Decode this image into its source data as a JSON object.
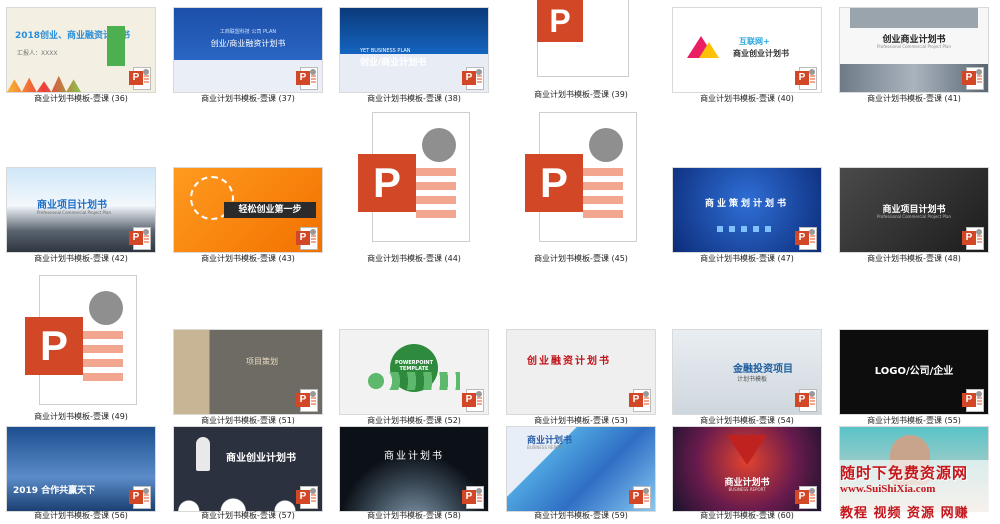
{
  "tiles": [
    {
      "caption": "商业计划书模板-壹课 (36)",
      "title": "2018创业、商业融资计划书",
      "sub": "汇报人：XXXX"
    },
    {
      "caption": "商业计划书模板-壹课 (37)",
      "title": "创业/商业融资计划书",
      "sub": "工商联盟科技 公司 PLAN"
    },
    {
      "caption": "商业计划书模板-壹课 (38)",
      "title": "创业/商业计划书",
      "sub": "YET BUSINESS PLAN"
    },
    {
      "caption": "商业计划书模板-壹课 (39)"
    },
    {
      "caption": "商业计划书模板-壹课 (40)",
      "title": "商业创业计划书",
      "sub": "互联网+"
    },
    {
      "caption": "商业计划书模板-壹课 (41)",
      "title": "创业商业计划书",
      "sub": "Professional Commercial Project Plan"
    },
    {
      "caption": "商业计划书模板-壹课 (42)",
      "title": "商业项目计划书",
      "sub": "Professional Commercial Project Plan"
    },
    {
      "caption": "商业计划书模板-壹课 (43)",
      "title": "轻松创业第一步"
    },
    {
      "caption": "商业计划书模板-壹课 (44)"
    },
    {
      "caption": "商业计划书模板-壹课 (45)"
    },
    {
      "caption": "商业计划书模板-壹课 (47)",
      "title": "商业策划计划书"
    },
    {
      "caption": "商业计划书模板-壹课 (48)",
      "title": "商业项目计划书",
      "sub": "Professional Commercial Project Plan"
    },
    {
      "caption": "商业计划书模板-壹课 (49)"
    },
    {
      "caption": "商业计划书模板-壹课 (51)",
      "title": "项目策划"
    },
    {
      "caption": "商业计划书模板-壹课 (52)",
      "title": "POWERPOINT TEMPLATE"
    },
    {
      "caption": "商业计划书模板-壹课 (53)",
      "title": "创业融资计划书"
    },
    {
      "caption": "商业计划书模板-壹课 (54)",
      "title": "金融投资项目",
      "sub": "计划书模板"
    },
    {
      "caption": "商业计划书模板-壹课 (55)",
      "title": "LOGO/公司/企业"
    },
    {
      "caption": "商业计划书模板-壹课 (56)",
      "title": "2019 合作共赢天下"
    },
    {
      "caption": "商业计划书模板-壹课 (57)",
      "title": "商业创业计划书"
    },
    {
      "caption": "商业计划书模板-壹课 (58)",
      "title": "商业计划书"
    },
    {
      "caption": "商业计划书模板-壹课 (59)",
      "title": "商业计划书",
      "sub": "BUSINESS REPORT"
    },
    {
      "caption": "商业计划书模板-壹课 (60)",
      "title": "商业计划书",
      "sub": "BUSINESS REPORT"
    },
    {
      "caption": ""
    }
  ],
  "watermark": {
    "line1": "随时下免费资源网",
    "line2": "www.SuiShiXia.com",
    "line3": "教程 视频 资源 网赚"
  },
  "colors": {
    "ppt_red": "#d24726",
    "ppt_peach": "#f2a58f",
    "pie_gray": "#8a8a8a"
  }
}
